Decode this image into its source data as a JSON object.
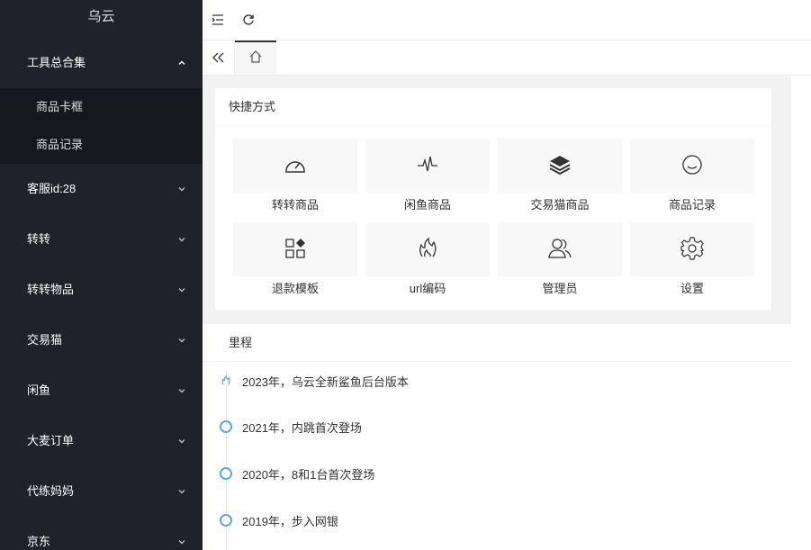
{
  "app": {
    "title": "乌云"
  },
  "sidebar": {
    "groups": [
      {
        "label": "工具总合集",
        "expanded": true,
        "items": [
          {
            "label": "商品卡框"
          },
          {
            "label": "商品记录"
          }
        ]
      },
      {
        "label": "客服id:28",
        "expanded": false
      },
      {
        "label": "转转",
        "expanded": false
      },
      {
        "label": "转转物品",
        "expanded": false
      },
      {
        "label": "交易猫",
        "expanded": false
      },
      {
        "label": "闲鱼",
        "expanded": false
      },
      {
        "label": "大麦订单",
        "expanded": false
      },
      {
        "label": "代练妈妈",
        "expanded": false
      },
      {
        "label": "京东",
        "expanded": false
      }
    ]
  },
  "header": {
    "menu_icon": "fold-menu-icon",
    "refresh_icon": "refresh-icon"
  },
  "tabs": {
    "prev_icon": "double-left-icon",
    "home_icon": "home-icon"
  },
  "shortcuts": {
    "title": "快捷方式",
    "items": [
      {
        "label": "转转商品",
        "icon": "dashboard-icon"
      },
      {
        "label": "闲鱼商品",
        "icon": "pulse-icon"
      },
      {
        "label": "交易猫商品",
        "icon": "layers-icon"
      },
      {
        "label": "商品记录",
        "icon": "smile-icon"
      },
      {
        "label": "退款模板",
        "icon": "apps-icon"
      },
      {
        "label": "url编码",
        "icon": "fire-icon"
      },
      {
        "label": "管理员",
        "icon": "users-icon"
      },
      {
        "label": "设置",
        "icon": "gear-icon"
      }
    ]
  },
  "timeline": {
    "title": "里程",
    "items": [
      {
        "text": "2023年，乌云全新鲨鱼后台版本",
        "icon": "fire-icon"
      },
      {
        "text": "2021年，内跳首次登场",
        "icon": "circle-icon"
      },
      {
        "text": "2020年，8和1台首次登场",
        "icon": "circle-icon"
      },
      {
        "text": "2019年，步入网银",
        "icon": "circle-icon"
      }
    ]
  },
  "colors": {
    "sidebar_bg": "#20222a",
    "submenu_bg": "#17181d",
    "accent": "#5fa4e8"
  }
}
